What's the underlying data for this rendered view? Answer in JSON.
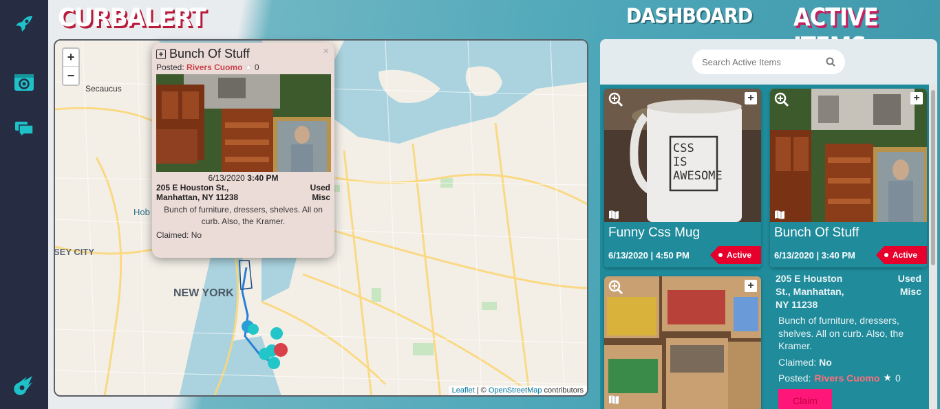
{
  "app": {
    "brand": "CURBALERT"
  },
  "nav": {
    "dashboard": "DASHBOARD",
    "active_items": "ACTIVE ITEMS"
  },
  "sidebar": {
    "icons": [
      "rocket-icon",
      "camera-icon",
      "chat-icon",
      "meteor-icon"
    ]
  },
  "map": {
    "zoom_in": "+",
    "zoom_out": "−",
    "labels": {
      "secaucus": "Secaucus",
      "hoboken": "Hob",
      "jersey_city": "SEY CITY",
      "new_york": "NEW YORK"
    },
    "attribution": {
      "leaflet": "Leaflet",
      "sep": " | © ",
      "osm": "OpenStreetMap",
      "suffix": " contributors"
    }
  },
  "popup": {
    "title": "Bunch Of Stuff",
    "close": "×",
    "posted_label": "Posted:",
    "user": "Rivers Cuomo",
    "stars": "0",
    "date": "6/13/2020",
    "time": "3:40 PM",
    "address_line1": "205 E Houston St.,",
    "address_line2": "Manhattan, NY 11238",
    "condition": "Used",
    "category": "Misc",
    "description": "Bunch of furniture, dressers, shelves. All on curb. Also, the Kramer.",
    "claimed_label": "Claimed:",
    "claimed_value": "No"
  },
  "panel": {
    "search_placeholder": "Search Active Items",
    "cards": [
      {
        "title": "Funny Css Mug",
        "date": "6/13/2020 | 4:50 PM",
        "status": "Active",
        "mug_text": [
          "CSS",
          "IS",
          "AWESOME"
        ]
      },
      {
        "title": "Bunch Of Stuff",
        "date": "6/13/2020 | 3:40 PM",
        "status": "Active"
      }
    ],
    "detail": {
      "address_line1": "205 E Houston",
      "address_line2": "St., Manhattan,",
      "address_line3": "NY 11238",
      "condition": "Used",
      "category": "Misc",
      "description": "Bunch of furniture, dressers, shelves. All on curb. Also, the Kramer.",
      "claimed_label": "Claimed:",
      "claimed_value": "No",
      "posted_label": "Posted:",
      "user": "Rivers Cuomo",
      "stars": "0",
      "claim_button": "Claim"
    }
  },
  "colors": {
    "sidebar": "#262c42",
    "teal": "#1f8b9b",
    "active_red": "#e6002b",
    "claim_pink": "#ff1679",
    "brand_shadow": "#b81a3a"
  }
}
